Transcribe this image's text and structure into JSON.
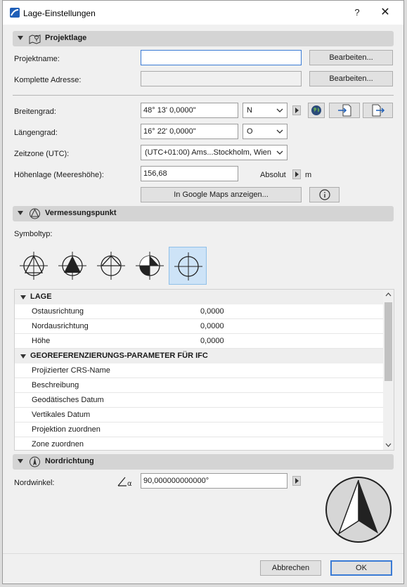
{
  "window": {
    "title": "Lage-Einstellungen",
    "help": "?",
    "close": "✕"
  },
  "projektlage": {
    "title": "Projektlage",
    "projektname_label": "Projektname:",
    "projektname_value": "",
    "adresse_label": "Komplette Adresse:",
    "adresse_value": "",
    "bearbeiten1": "Bearbeiten...",
    "bearbeiten2": "Bearbeiten...",
    "breitengrad_label": "Breitengrad:",
    "breitengrad_value": "48° 13' 0,0000\"",
    "breitengrad_dir": "N",
    "laengengrad_label": "Längengrad:",
    "laengengrad_value": "16° 22' 0,0000\"",
    "laengengrad_dir": "O",
    "zeitzone_label": "Zeitzone (UTC):",
    "zeitzone_value": "(UTC+01:00) Ams...Stockholm, Wien",
    "hoehe_label": "Höhenlage (Meereshöhe):",
    "hoehe_value": "156,68",
    "absolut": "Absolut",
    "unit": "m",
    "google_maps": "In Google Maps anzeigen...",
    "info": "i"
  },
  "vermessung": {
    "title": "Vermessungspunkt",
    "symboltyp_label": "Symboltyp:",
    "symbols": [
      "circle-cross-outline-triangle",
      "circle-cross-filled-triangle",
      "circle-cross-half-diamond",
      "circle-cross-quarter-filled",
      "circle-crosshair"
    ],
    "selected_symbol": 4,
    "table": {
      "group1": "LAGE",
      "rows1": [
        {
          "name": "Ostausrichtung",
          "value": "0,0000"
        },
        {
          "name": "Nordausrichtung",
          "value": "0,0000"
        },
        {
          "name": "Höhe",
          "value": "0,0000"
        }
      ],
      "group2": "GEOREFERENZIERUNGS-PARAMETER FÜR IFC",
      "rows2": [
        {
          "name": "Projizierter CRS-Name",
          "value": ""
        },
        {
          "name": "Beschreibung",
          "value": ""
        },
        {
          "name": "Geodätisches Datum",
          "value": ""
        },
        {
          "name": "Vertikales Datum",
          "value": ""
        },
        {
          "name": "Projektion zuordnen",
          "value": ""
        },
        {
          "name": "Zone zuordnen",
          "value": ""
        }
      ]
    }
  },
  "nordrichtung": {
    "title": "Nordrichtung",
    "nordwinkel_label": "Nordwinkel:",
    "nordwinkel_value": "90,000000000000°"
  },
  "footer": {
    "cancel": "Abbrechen",
    "ok": "OK"
  },
  "colors": {
    "accent": "#3a7bd5",
    "section_bg": "#d4d4d4",
    "selected_bg": "#cde3f7"
  }
}
